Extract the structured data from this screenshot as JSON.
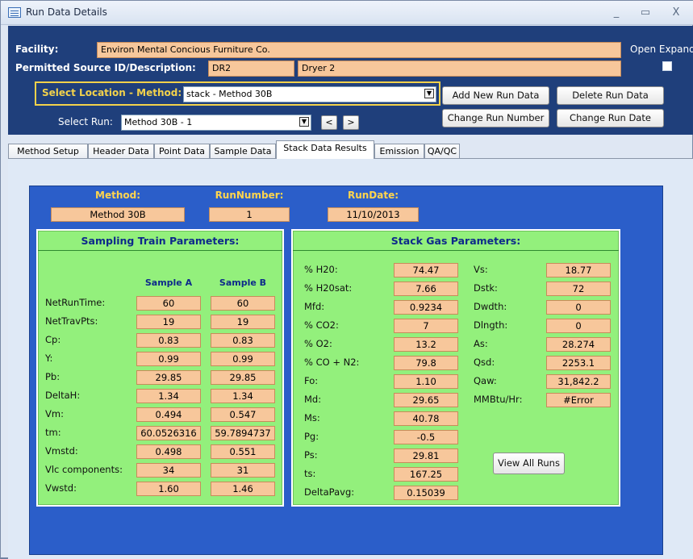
{
  "window": {
    "title": "Run Data Details",
    "minimize": "_",
    "maximize": "▭",
    "close": "X"
  },
  "header": {
    "facility_label": "Facility:",
    "facility_value": "Environ Mental Concious Furniture Co.",
    "permitted_label": "Permitted Source ID/Description:",
    "source_id": "DR2",
    "source_desc": "Dryer 2",
    "open_expanded_label": "Open Expande",
    "select_location_label": "Select Location - Method:",
    "select_location_value": "stack - Method 30B",
    "select_run_label": "Select Run:",
    "select_run_value": "Method 30B - 1",
    "prev_label": "<",
    "next_label": ">",
    "add_new_run": "Add New Run Data",
    "delete_run": "Delete Run Data",
    "change_run_number": "Change Run Number",
    "change_run_date": "Change Run Date"
  },
  "tabs": [
    "Method Setup",
    "Header Data",
    "Point Data",
    "Sample Data",
    "Stack Data Results",
    "Emission",
    "QA/QC"
  ],
  "results": {
    "method_label": "Method:",
    "method_value": "Method 30B",
    "runnumber_label": "RunNumber:",
    "runnumber_value": "1",
    "rundate_label": "RunDate:",
    "rundate_value": "11/10/2013"
  },
  "sampling": {
    "title": "Sampling Train Parameters:",
    "col_a": "Sample A",
    "col_b": "Sample B",
    "rows": [
      {
        "label": "NetRunTime:",
        "a": "60",
        "b": "60"
      },
      {
        "label": "NetTravPts:",
        "a": "19",
        "b": "19"
      },
      {
        "label": "Cp:",
        "a": "0.83",
        "b": "0.83"
      },
      {
        "label": "Y:",
        "a": "0.99",
        "b": "0.99"
      },
      {
        "label": "Pb:",
        "a": "29.85",
        "b": "29.85"
      },
      {
        "label": "DeltaH:",
        "a": "1.34",
        "b": "1.34"
      },
      {
        "label": "Vm:",
        "a": "0.494",
        "b": "0.547"
      },
      {
        "label": "tm:",
        "a": "60.0526316",
        "b": "59.7894737"
      },
      {
        "label": "Vmstd:",
        "a": "0.498",
        "b": "0.551"
      },
      {
        "label": "Vlc components:",
        "a": "34",
        "b": "31"
      },
      {
        "label": "Vwstd:",
        "a": "1.60",
        "b": "1.46"
      }
    ]
  },
  "stack": {
    "title": "Stack Gas Parameters:",
    "left": [
      {
        "label": "% H20:",
        "value": "74.47"
      },
      {
        "label": "% H20sat:",
        "value": "7.66"
      },
      {
        "label": "Mfd:",
        "value": "0.9234"
      },
      {
        "label": "% CO2:",
        "value": "7"
      },
      {
        "label": "% O2:",
        "value": "13.2"
      },
      {
        "label": "% CO + N2:",
        "value": "79.8"
      },
      {
        "label": "Fo:",
        "value": "1.10"
      },
      {
        "label": "Md:",
        "value": "29.65"
      },
      {
        "label": "Ms:",
        "value": "40.78"
      },
      {
        "label": "Pg:",
        "value": "-0.5"
      },
      {
        "label": "Ps:",
        "value": "29.81"
      },
      {
        "label": "ts:",
        "value": "167.25"
      },
      {
        "label": "DeltaPavg:",
        "value": "0.15039"
      }
    ],
    "right": [
      {
        "label": "Vs:",
        "value": "18.77"
      },
      {
        "label": "Dstk:",
        "value": "72"
      },
      {
        "label": "Dwdth:",
        "value": "0"
      },
      {
        "label": "Dlngth:",
        "value": "0"
      },
      {
        "label": "As:",
        "value": "28.274"
      },
      {
        "label": "Qsd:",
        "value": "2253.1"
      },
      {
        "label": "Qaw:",
        "value": "31,842.2"
      },
      {
        "label": "MMBtu/Hr:",
        "value": "#Error"
      }
    ],
    "view_all_runs": "View All Runs"
  }
}
